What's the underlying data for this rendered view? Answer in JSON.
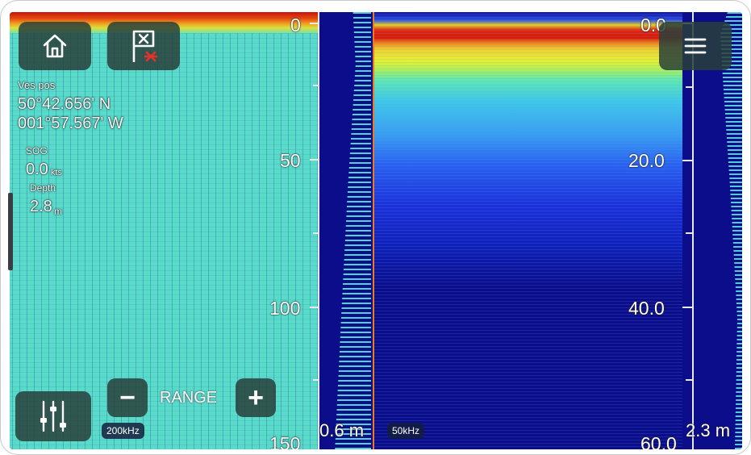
{
  "vessel": {
    "pos_label": "Ves pos",
    "lat": "50°42.656' N",
    "lon": "001°57.567' W",
    "sog_label": "SOG",
    "sog_value": "0.0",
    "sog_unit": "kts",
    "depth_label": "Depth",
    "depth_value": "2.8",
    "depth_unit": "m"
  },
  "left_pane": {
    "frequency": "200kHz",
    "scale_ticks": [
      "0",
      "50",
      "100",
      "150"
    ],
    "bottom_depth": "0.6 m"
  },
  "right_pane": {
    "frequency": "50kHz",
    "scale_ticks": [
      "0.0",
      "20.0",
      "40.0",
      "60.0"
    ],
    "bottom_depth": "2.3 m"
  },
  "range_control": {
    "label": "RANGE",
    "minus": "−",
    "plus": "+"
  },
  "icons": {
    "home": "home-icon",
    "waypoint": "waypoint-flag-icon",
    "menu": "hamburger-menu-icon",
    "settings": "sliders-icon"
  },
  "colors": {
    "button_bg": "#28403a",
    "divider": "#f07a1a",
    "deep_water": "#0c0d8a"
  }
}
